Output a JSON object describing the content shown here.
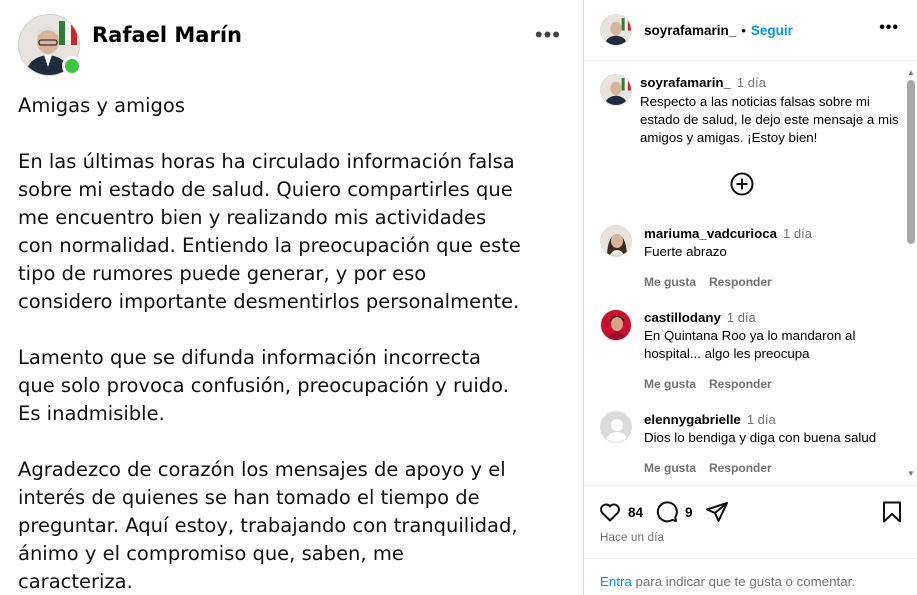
{
  "post": {
    "author": "Rafael Marín",
    "paragraphs": [
      "Amigas y amigos",
      "En las últimas horas ha circulado información falsa\nsobre mi estado de salud. Quiero compartirles que\nme encuentro bien y realizando mis actividades\ncon normalidad. Entiendo la preocupación que este\ntipo de rumores puede generar, y por eso\nconsidero importante desmentirlos personalmente.",
      "Lamento que se difunda información incorrecta\nque solo provoca confusión, preocupación y ruido.\nEs inadmisible.",
      "Agradezco de corazón los mensajes de apoyo y el\ninterés de quienes se han tomado el tiempo de\npreguntar. Aquí estoy, trabajando con tranquilidad,\nánimo y el compromiso que, saben, me\ncaracteriza."
    ],
    "more_icon": "more-horizontal-icon"
  },
  "sidebar": {
    "header": {
      "username": "soyrafamarin_",
      "dot": "•",
      "follow_label": "Seguir",
      "more_icon": "more-horizontal-icon"
    },
    "caption": {
      "username": "soyrafamarin_",
      "time": "1 día",
      "text": "Respecto a las noticias falsas sobre mi estado de salud, le dejo este mensaje a mis amigos y amigas. ¡Estoy bien!"
    },
    "load_more_icon": "plus-circle-icon",
    "comments": [
      {
        "username": "mariuma_vadcurioca",
        "time": "1 día",
        "text": "Fuerte abrazo",
        "like_label": "Me gusta",
        "reply_label": "Responder"
      },
      {
        "username": "castillodany",
        "time": "1 día",
        "text": "En Quintana Roo ya lo mandaron al hospital... algo les preocupa",
        "like_label": "Me gusta",
        "reply_label": "Responder"
      },
      {
        "username": "elennygabrielle",
        "time": "1 día",
        "text": "Dios lo bendiga y diga con buena salud",
        "like_label": "Me gusta",
        "reply_label": "Responder"
      }
    ],
    "actions": {
      "likes": "84",
      "comments": "9",
      "icons": [
        "heart-icon",
        "comment-icon",
        "share-icon",
        "bookmark-icon"
      ]
    },
    "date": "Hace un día",
    "login_link": "Entra",
    "login_text": " para indicar que te gusta o comentar."
  },
  "colors": {
    "accent": "#0095f6",
    "online": "#3ec43e",
    "muted": "#737373"
  }
}
